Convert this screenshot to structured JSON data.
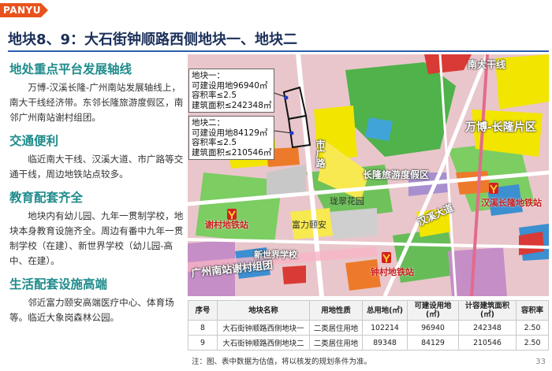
{
  "brand": "PANYU",
  "title": "地块8、9：大石街钟顺路西侧地块一、地块二",
  "sections": [
    {
      "heading": "地处重点平台发展轴线",
      "body": "万博-汉溪长隆-广州南站发展轴线上，南大干线经济带。东邻长隆旅游度假区，南邻广州南站谢村组团。"
    },
    {
      "heading": "交通便利",
      "body": "临近南大干线、汉溪大道、市广路等交通干线，周边地铁站点较多。"
    },
    {
      "heading": "教育配套齐全",
      "body": "地块内有幼儿园、九年一贯制学校，地块本身教育设施齐全。周边有番中九年一贯制学校（在建）、新世界学校（幼儿园-高中、在建）。"
    },
    {
      "heading": "生活配套设施高端",
      "body": "邻近富力颐安高端医疗中心、体育场等。临近大象岗森林公园。"
    }
  ],
  "map": {
    "labels": {
      "nandaganxian": "南大干线",
      "wanbo": "万博-长隆片区",
      "shiguanglu": "市广路",
      "changlong": "长隆旅游度假区",
      "longcui": "珑翠花园",
      "fuli": "富力颐安",
      "hanxidadao": "汉溪大道",
      "xinshijie": "新世界学校",
      "guangzhounan": "广州南站谢村组团",
      "xiecun_metro": "谢村地铁站",
      "hanxi_metro": "汉溪长隆地铁站",
      "zhongcun_metro": "钟村地铁站"
    },
    "plot1": {
      "title": "地块一：",
      "lines": [
        "可建设用地96940㎡",
        "容积率≤2.5",
        "建筑面积≤242348㎡"
      ]
    },
    "plot2": {
      "title": "地块二：",
      "lines": [
        "可建设用地84129㎡",
        "容积率≤2.5",
        "建筑面积≤210546㎡"
      ]
    }
  },
  "table": {
    "headers": [
      "序号",
      "地块名称",
      "用地性质",
      "总用地(㎡)",
      "可建设用地(㎡)",
      "计容建筑面积(㎡)",
      "容积率"
    ],
    "rows": [
      [
        "8",
        "大石街钟顺路西侧地块一",
        "二类居住用地",
        "102214",
        "96940",
        "242348",
        "2.50"
      ],
      [
        "9",
        "大石街钟顺路西侧地块二",
        "二类居住用地",
        "89348",
        "84129",
        "210546",
        "2.50"
      ]
    ]
  },
  "note": "注：图、表中数据为估值，将以核发的规划条件为准。",
  "page_number": "33",
  "colors": {
    "brand": "#e8531c",
    "heading": "#1f8b8b",
    "title": "#1b2f59",
    "rule": "#2a5db0"
  }
}
